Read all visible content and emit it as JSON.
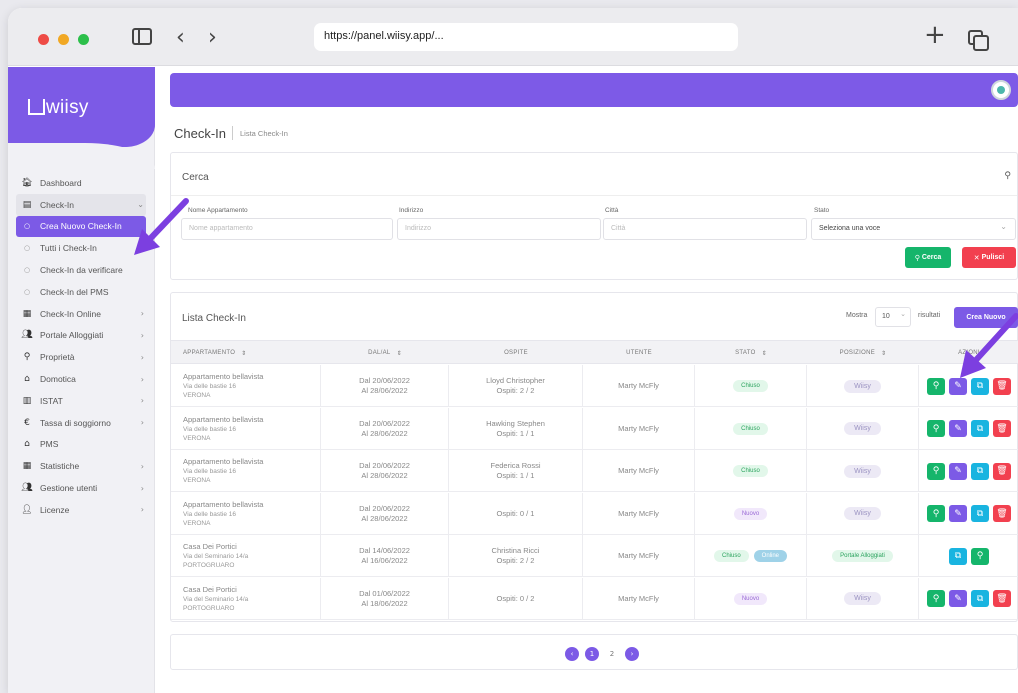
{
  "browser": {
    "url": "https://panel.wiisy.app/...",
    "back_icon": "chevron-left-icon",
    "forward_icon": "chevron-right-icon",
    "new_tab": "+"
  },
  "sidebar": {
    "logo": "wiisy",
    "items": [
      {
        "label": "Dashboard",
        "icon": "home-icon",
        "glyph": "🏠︎",
        "chevron": "",
        "kind": "main"
      },
      {
        "label": "Check-In",
        "icon": "list-icon",
        "glyph": "▤",
        "chevron": "⌄",
        "kind": "open"
      },
      {
        "label": "Crea Nuovo Check-In",
        "icon": "circle-icon",
        "glyph": "○",
        "chevron": "",
        "kind": "active"
      },
      {
        "label": "Tutti i Check-In",
        "icon": "circle-icon",
        "glyph": "○",
        "chevron": "",
        "kind": "sub"
      },
      {
        "label": "Check-In da verificare",
        "icon": "circle-icon",
        "glyph": "○",
        "chevron": "",
        "kind": "sub"
      },
      {
        "label": "Check-In del PMS",
        "icon": "circle-icon",
        "glyph": "○",
        "chevron": "",
        "kind": "sub"
      },
      {
        "label": "Check-In Online",
        "icon": "calendar-icon",
        "glyph": "▦",
        "chevron": "›",
        "kind": "main"
      },
      {
        "label": "Portale Alloggiati",
        "icon": "users-icon",
        "glyph": "👥︎",
        "chevron": "›",
        "kind": "main"
      },
      {
        "label": "Proprietà",
        "icon": "location-pin-icon",
        "glyph": "⚲",
        "chevron": "›",
        "kind": "main"
      },
      {
        "label": "Domotica",
        "icon": "smart-home-icon",
        "glyph": "⌂",
        "chevron": "›",
        "kind": "main"
      },
      {
        "label": "ISTAT",
        "icon": "chart-icon",
        "glyph": "▥",
        "chevron": "›",
        "kind": "main"
      },
      {
        "label": "Tassa di soggiorno",
        "icon": "euro-icon",
        "glyph": "€",
        "chevron": "›",
        "kind": "main"
      },
      {
        "label": "PMS",
        "icon": "building-icon",
        "glyph": "⌂",
        "chevron": "",
        "kind": "main"
      },
      {
        "label": "Statistiche",
        "icon": "table-icon",
        "glyph": "▦",
        "chevron": "›",
        "kind": "main"
      },
      {
        "label": "Gestione utenti",
        "icon": "user-group-icon",
        "glyph": "👥︎",
        "chevron": "›",
        "kind": "main"
      },
      {
        "label": "Licenze",
        "icon": "user-key-icon",
        "glyph": "👤︎",
        "chevron": "›",
        "kind": "main"
      }
    ]
  },
  "header": {
    "title": "Check-In",
    "breadcrumb": "Lista Check-In"
  },
  "search": {
    "title": "Cerca",
    "fields": [
      {
        "label": "Nome Appartamento",
        "placeholder": "Nome appartamento"
      },
      {
        "label": "Indirizzo",
        "placeholder": "Indirizzo"
      },
      {
        "label": "Città",
        "placeholder": "Città"
      },
      {
        "label": "Stato",
        "placeholder": "Seleziona una voce"
      }
    ],
    "search_button": "Cerca",
    "clear_button": "Pulisci"
  },
  "list": {
    "title": "Lista Check-In",
    "show_label": "Mostra",
    "page_size": "10",
    "results_label": "risultati",
    "new_button": "Crea Nuovo",
    "columns": [
      "APPARTAMENTO",
      "DAL/AL",
      "OSPITE",
      "UTENTE",
      "STATO",
      "POSIZIONE",
      "AZIONI"
    ],
    "rows": [
      {
        "apt": "Appartamento bellavista",
        "addr": "Via delle bastie 16",
        "city": "VERONA",
        "dal": "Dal 20/06/2022",
        "al": "Al 28/06/2022",
        "guest": "Lloyd Christopher",
        "guests": "Ospiti: 2 / 2",
        "user": "Marty McFly",
        "status": "Chiuso",
        "status_kind": "chiuso",
        "status2": "",
        "position": "Wiisy",
        "position_kind": "wiisy",
        "actions": [
          "view",
          "edit",
          "copy",
          "del"
        ]
      },
      {
        "apt": "Appartamento bellavista",
        "addr": "Via delle bastie 16",
        "city": "VERONA",
        "dal": "Dal 20/06/2022",
        "al": "Al 28/06/2022",
        "guest": "Hawking Stephen",
        "guests": "Ospiti: 1 / 1",
        "user": "Marty McFly",
        "status": "Chiuso",
        "status_kind": "chiuso",
        "status2": "",
        "position": "Wiisy",
        "position_kind": "wiisy",
        "actions": [
          "view",
          "edit",
          "copy",
          "del"
        ]
      },
      {
        "apt": "Appartamento bellavista",
        "addr": "Via delle bastie 16",
        "city": "VERONA",
        "dal": "Dal 20/06/2022",
        "al": "Al 28/06/2022",
        "guest": "Federica Rossi",
        "guests": "Ospiti: 1 / 1",
        "user": "Marty McFly",
        "status": "Chiuso",
        "status_kind": "chiuso",
        "status2": "",
        "position": "Wiisy",
        "position_kind": "wiisy",
        "actions": [
          "view",
          "edit",
          "copy",
          "del"
        ]
      },
      {
        "apt": "Appartamento bellavista",
        "addr": "Via delle bastie 16",
        "city": "VERONA",
        "dal": "Dal 20/06/2022",
        "al": "Al 28/06/2022",
        "guest": "",
        "guests": "Ospiti: 0 / 1",
        "user": "Marty McFly",
        "status": "Nuovo",
        "status_kind": "nuovo",
        "status2": "",
        "position": "Wiisy",
        "position_kind": "wiisy",
        "actions": [
          "view",
          "edit",
          "copy",
          "del"
        ]
      },
      {
        "apt": "Casa Dei Portici",
        "addr": "Via del Seminario 14/a",
        "city": "PORTOGRUARO",
        "dal": "Dal 14/06/2022",
        "al": "Al 16/06/2022",
        "guest": "Christina Ricci",
        "guests": "Ospiti: 2 / 2",
        "user": "Marty McFly",
        "status": "Chiuso",
        "status_kind": "chiuso",
        "status2": "Online",
        "position": "Portale Alloggiati",
        "position_kind": "portale",
        "actions": [
          "copy",
          "view"
        ]
      },
      {
        "apt": "Casa Dei Portici",
        "addr": "Via del Seminario 14/a",
        "city": "PORTOGRUARO",
        "dal": "Dal 01/06/2022",
        "al": "Al 18/06/2022",
        "guest": "",
        "guests": "Ospiti: 0 / 2",
        "user": "Marty McFly",
        "status": "Nuovo",
        "status_kind": "nuovo",
        "status2": "",
        "position": "Wiisy",
        "position_kind": "wiisy",
        "actions": [
          "view",
          "edit",
          "copy",
          "del"
        ]
      }
    ]
  },
  "pagination": {
    "pages": [
      "1",
      "2"
    ],
    "current": "1"
  },
  "colors": {
    "accent": "#7c5ae6",
    "success": "#15b56b",
    "danger": "#f2404f",
    "info": "#19b4e0"
  },
  "icons": {
    "sort": "sort-icon",
    "search": "search-icon",
    "annotation_arrows": "arrow-icon"
  }
}
